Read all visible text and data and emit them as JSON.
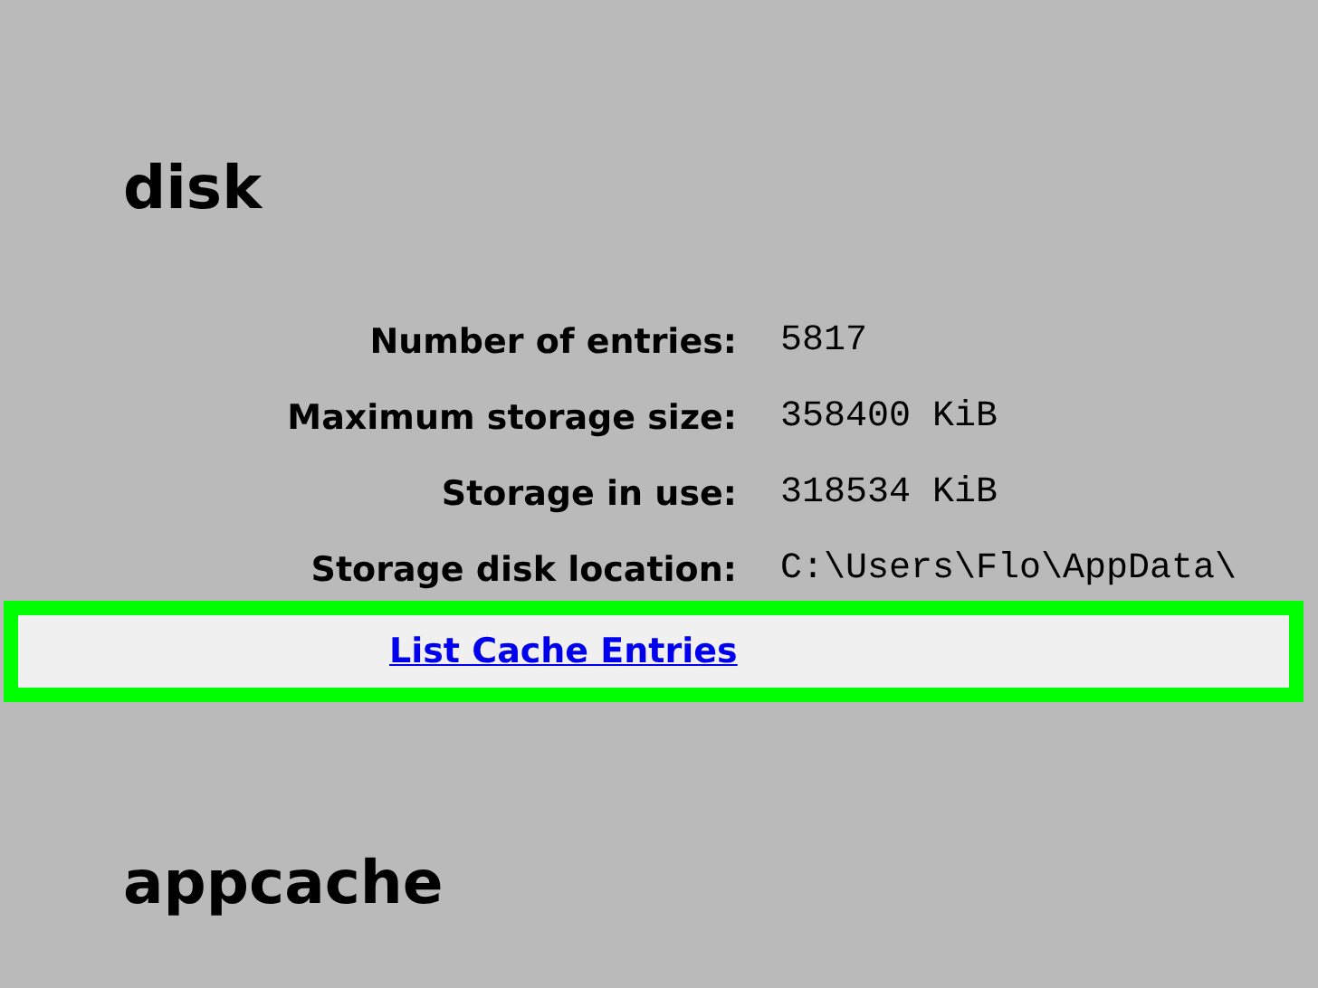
{
  "sections": [
    {
      "title": "disk",
      "entries": [
        {
          "label": "Number of entries:",
          "value": "5817"
        },
        {
          "label": "Maximum storage size:",
          "value": "358400 KiB"
        },
        {
          "label": "Storage in use:",
          "value": "318534 KiB"
        },
        {
          "label": "Storage disk location:",
          "value": "C:\\Users\\Flo\\AppData\\"
        }
      ],
      "link": {
        "label": "List Cache Entries",
        "highlighted": true
      }
    },
    {
      "title": "appcache"
    }
  ]
}
